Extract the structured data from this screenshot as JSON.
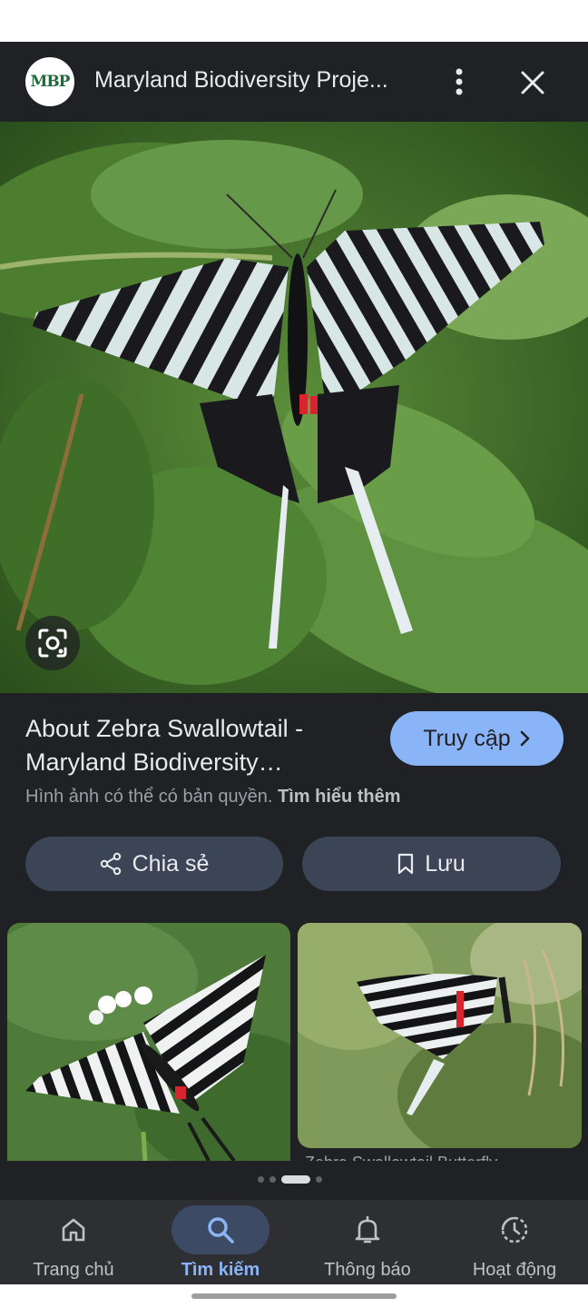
{
  "header": {
    "logo_text": "MBP",
    "site_title": "Maryland Biodiversity Proje..."
  },
  "main_image": {
    "subject": "zebra-swallowtail-butterfly"
  },
  "result": {
    "title_line1": "About Zebra Swallowtail -",
    "title_line2": "Maryland Biodiversity…",
    "visit_label": "Truy cập",
    "copyright_text": "Hình ảnh có thể có bản quyền.",
    "learn_more": "Tìm hiểu thêm"
  },
  "actions": {
    "share_label": "Chia sẻ",
    "save_label": "Lưu"
  },
  "related": {
    "caption_partial": "Zebra Swallowtail Butterfly"
  },
  "pager": {
    "count": 4,
    "active_index": 2
  },
  "bottom_nav": {
    "items": [
      {
        "label": "Trang chủ",
        "icon": "home-icon"
      },
      {
        "label": "Tìm kiếm",
        "icon": "search-icon",
        "active": true
      },
      {
        "label": "Thông báo",
        "icon": "bell-icon"
      },
      {
        "label": "Hoạt động",
        "icon": "activity-icon"
      }
    ]
  },
  "colors": {
    "background": "#202124",
    "accent": "#8ab4f8",
    "pill": "#3c4555",
    "nav_bg": "#2d2f33"
  }
}
